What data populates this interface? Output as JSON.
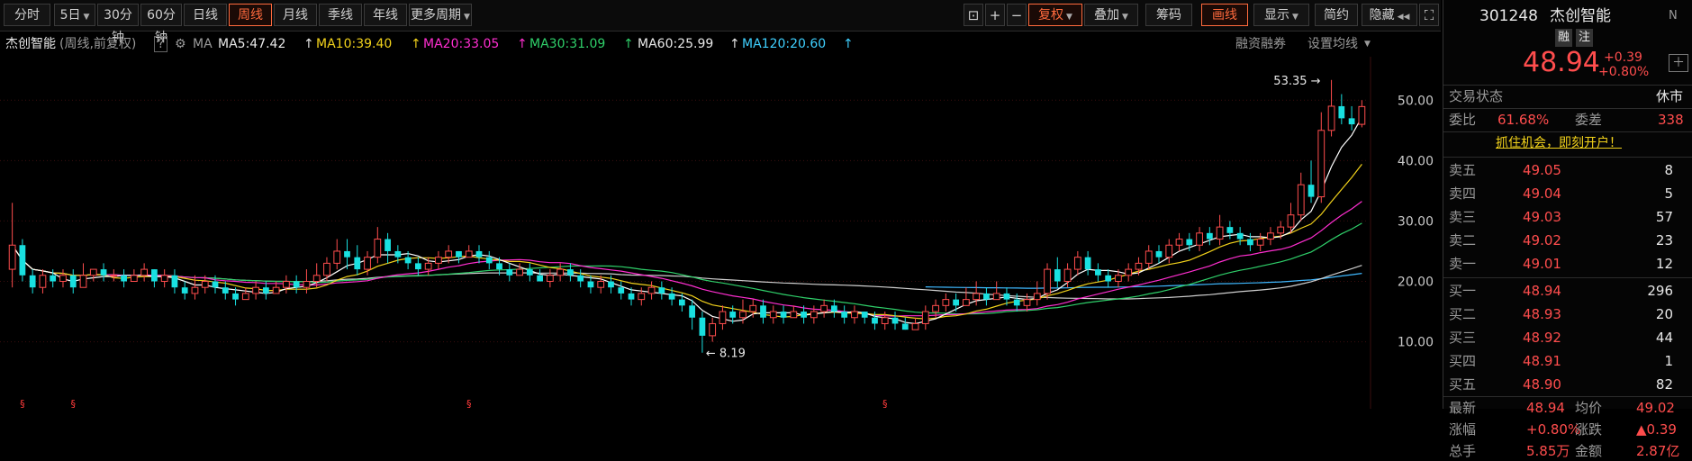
{
  "toolbar": {
    "periods": [
      "分时",
      "5日",
      "30分钟",
      "60分钟",
      "日线",
      "周线",
      "月线",
      "季线",
      "年线",
      "更多周期"
    ],
    "active_period": "周线",
    "tools": {
      "zoom_out": "−",
      "zoom_in": "+",
      "minus": "−",
      "rights": "复权",
      "overlay": "叠加",
      "chips": "筹码",
      "draw": "画线",
      "display": "显示",
      "simple": "简约",
      "hide": "隐藏"
    }
  },
  "info": {
    "stock_name": "杰创智能",
    "mode": "(周线,前复权)",
    "help": "?",
    "ma_label": "MA",
    "ma5": "MA5:47.42",
    "ma10": "MA10:39.40",
    "ma20": "MA20:33.05",
    "ma30": "MA30:31.09",
    "ma60": "MA60:25.99",
    "ma120": "MA120:20.60",
    "margin": "融资融券",
    "set_ma": "设置均线"
  },
  "colors": {
    "up": "#ff4d4d",
    "down": "#19e0e0",
    "ma5": "#ffffff",
    "ma10": "#f2d21b",
    "ma20": "#ff2ed0",
    "ma30": "#2fd06a",
    "ma60": "#cfcfcf",
    "ma120": "#3fb8ff",
    "accent": "#ff6a3d"
  },
  "chart_data": {
    "type": "candlestick",
    "y_ticks": [
      "50.00",
      "40.00",
      "30.00",
      "20.00",
      "10.00"
    ],
    "ylim": [
      8,
      56
    ],
    "high_label": "53.35",
    "low_label": "8.19",
    "candles": [
      [
        22,
        26,
        19,
        33
      ],
      [
        26,
        21,
        20,
        27
      ],
      [
        21,
        19,
        18,
        22
      ],
      [
        19,
        21,
        18,
        22
      ],
      [
        21,
        20,
        19,
        22
      ],
      [
        20,
        21,
        19,
        22
      ],
      [
        21,
        19,
        18,
        22
      ],
      [
        19,
        21,
        19,
        23
      ],
      [
        21,
        22,
        20,
        22
      ],
      [
        22,
        21,
        20,
        23
      ],
      [
        21,
        21,
        20,
        22
      ],
      [
        21,
        20,
        19,
        22
      ],
      [
        20,
        21,
        20,
        22
      ],
      [
        21,
        22,
        20,
        23
      ],
      [
        22,
        20,
        19,
        22
      ],
      [
        20,
        21,
        19,
        22
      ],
      [
        21,
        19,
        18,
        22
      ],
      [
        19,
        18,
        17,
        20
      ],
      [
        18,
        19,
        17,
        21
      ],
      [
        19,
        20,
        18,
        21
      ],
      [
        20,
        19,
        18,
        21
      ],
      [
        19,
        18,
        17,
        20
      ],
      [
        18,
        17,
        16,
        19
      ],
      [
        17,
        18,
        17,
        19
      ],
      [
        18,
        19,
        17,
        20
      ],
      [
        19,
        18,
        17,
        20
      ],
      [
        18,
        19,
        18,
        20
      ],
      [
        19,
        20,
        18,
        21
      ],
      [
        20,
        19,
        18,
        21
      ],
      [
        19,
        20,
        18,
        22
      ],
      [
        20,
        21,
        19,
        23
      ],
      [
        21,
        23,
        20,
        24
      ],
      [
        23,
        25,
        22,
        27
      ],
      [
        25,
        24,
        22,
        27
      ],
      [
        24,
        22,
        21,
        26
      ],
      [
        22,
        24,
        21,
        25
      ],
      [
        24,
        27,
        23,
        29
      ],
      [
        27,
        25,
        23,
        28
      ],
      [
        25,
        24,
        23,
        26
      ],
      [
        24,
        23,
        22,
        25
      ],
      [
        23,
        22,
        21,
        24
      ],
      [
        22,
        23,
        21,
        24
      ],
      [
        23,
        24,
        22,
        25
      ],
      [
        24,
        25,
        23,
        26
      ],
      [
        25,
        24,
        23,
        25
      ],
      [
        24,
        25,
        24,
        26
      ],
      [
        25,
        24,
        23,
        26
      ],
      [
        24,
        23,
        22,
        25
      ],
      [
        23,
        22,
        21,
        24
      ],
      [
        22,
        21,
        20,
        23
      ],
      [
        21,
        22,
        21,
        23
      ],
      [
        22,
        21,
        20,
        23
      ],
      [
        21,
        20,
        20,
        22
      ],
      [
        20,
        21,
        19,
        22
      ],
      [
        21,
        22,
        20,
        23
      ],
      [
        22,
        21,
        20,
        23
      ],
      [
        21,
        20,
        19,
        22
      ],
      [
        20,
        19,
        18,
        21
      ],
      [
        19,
        20,
        18,
        21
      ],
      [
        20,
        19,
        18,
        21
      ],
      [
        19,
        18,
        17,
        20
      ],
      [
        18,
        17,
        16,
        19
      ],
      [
        17,
        18,
        16,
        19
      ],
      [
        18,
        19,
        17,
        20
      ],
      [
        19,
        18,
        17,
        20
      ],
      [
        18,
        17,
        16,
        19
      ],
      [
        17,
        16,
        15,
        18
      ],
      [
        16,
        14,
        12,
        17
      ],
      [
        14,
        11,
        8.19,
        15
      ],
      [
        11,
        13,
        10,
        14
      ],
      [
        13,
        15,
        12,
        16
      ],
      [
        15,
        14,
        13,
        16
      ],
      [
        14,
        15,
        13,
        17
      ],
      [
        15,
        16,
        14,
        17
      ],
      [
        16,
        14,
        13,
        17
      ],
      [
        14,
        15,
        13,
        16
      ],
      [
        15,
        14,
        13,
        16
      ],
      [
        14,
        15,
        14,
        16
      ],
      [
        15,
        14,
        13,
        16
      ],
      [
        14,
        15,
        13,
        16
      ],
      [
        15,
        16,
        14,
        17
      ],
      [
        16,
        15,
        14,
        17
      ],
      [
        15,
        14,
        13,
        16
      ],
      [
        14,
        15,
        13,
        16
      ],
      [
        15,
        14,
        13,
        15
      ],
      [
        14,
        13,
        12,
        15
      ],
      [
        13,
        14,
        12,
        15
      ],
      [
        14,
        13,
        12,
        15
      ],
      [
        13,
        12,
        12,
        14
      ],
      [
        12,
        13,
        12,
        14
      ],
      [
        13,
        15,
        12,
        16
      ],
      [
        15,
        16,
        14,
        17
      ],
      [
        16,
        17,
        15,
        18
      ],
      [
        17,
        16,
        15,
        18
      ],
      [
        16,
        17,
        16,
        19
      ],
      [
        17,
        18,
        16,
        20
      ],
      [
        18,
        17,
        16,
        19
      ],
      [
        17,
        18,
        17,
        20
      ],
      [
        18,
        17,
        16,
        19
      ],
      [
        17,
        16,
        15,
        18
      ],
      [
        16,
        17,
        15,
        18
      ],
      [
        17,
        18,
        16,
        20
      ],
      [
        18,
        22,
        17,
        23
      ],
      [
        22,
        20,
        19,
        24
      ],
      [
        20,
        22,
        19,
        23
      ],
      [
        22,
        24,
        21,
        25
      ],
      [
        24,
        22,
        21,
        25
      ],
      [
        22,
        21,
        20,
        23
      ],
      [
        21,
        20,
        19,
        22
      ],
      [
        20,
        21,
        19,
        22
      ],
      [
        21,
        22,
        20,
        23
      ],
      [
        22,
        23,
        21,
        24
      ],
      [
        23,
        25,
        22,
        26
      ],
      [
        25,
        24,
        23,
        26
      ],
      [
        24,
        26,
        23,
        27
      ],
      [
        26,
        27,
        25,
        28
      ],
      [
        27,
        26,
        25,
        28
      ],
      [
        26,
        28,
        25,
        29
      ],
      [
        28,
        27,
        26,
        29
      ],
      [
        27,
        29,
        26,
        31
      ],
      [
        29,
        28,
        27,
        30
      ],
      [
        28,
        27,
        26,
        29
      ],
      [
        27,
        26,
        25,
        28
      ],
      [
        26,
        27,
        25,
        28
      ],
      [
        27,
        28,
        26,
        29
      ],
      [
        28,
        29,
        27,
        30
      ],
      [
        29,
        31,
        28,
        33
      ],
      [
        31,
        36,
        30,
        38
      ],
      [
        36,
        34,
        33,
        40
      ],
      [
        34,
        45,
        33,
        48
      ],
      [
        45,
        49,
        44,
        53.35
      ],
      [
        49,
        47,
        46,
        51
      ],
      [
        47,
        46,
        45,
        49
      ],
      [
        46,
        48.94,
        45.5,
        50
      ]
    ]
  },
  "quote": {
    "code": "301248",
    "name": "杰创智能",
    "tag_margin": "融",
    "tag_note": "注",
    "price": "48.94",
    "change": "+0.39",
    "change_pct": "+0.80%",
    "status_label": "交易状态",
    "status_value": "休市",
    "webi_label": "委比",
    "webi_value": "61.68%",
    "weicha_label": "委差",
    "weicha_value": "338",
    "promo": "抓住机会，即刻开户！",
    "asks": [
      {
        "label": "卖五",
        "price": "49.05",
        "vol": "8"
      },
      {
        "label": "卖四",
        "price": "49.04",
        "vol": "5"
      },
      {
        "label": "卖三",
        "price": "49.03",
        "vol": "57"
      },
      {
        "label": "卖二",
        "price": "49.02",
        "vol": "23"
      },
      {
        "label": "卖一",
        "price": "49.01",
        "vol": "12"
      }
    ],
    "bids": [
      {
        "label": "买一",
        "price": "48.94",
        "vol": "296"
      },
      {
        "label": "买二",
        "price": "48.93",
        "vol": "20"
      },
      {
        "label": "买三",
        "price": "48.92",
        "vol": "44"
      },
      {
        "label": "买四",
        "price": "48.91",
        "vol": "1"
      },
      {
        "label": "买五",
        "price": "48.90",
        "vol": "82"
      }
    ],
    "stats": [
      {
        "l1": "最新",
        "v1": "48.94",
        "l2": "均价",
        "v2": "49.02"
      },
      {
        "l1": "涨幅",
        "v1": "+0.80%",
        "l2": "涨跌",
        "v2": "▲0.39"
      },
      {
        "l1": "总手",
        "v1": "5.85万",
        "l2": "金额",
        "v2": "2.87亿"
      }
    ]
  }
}
